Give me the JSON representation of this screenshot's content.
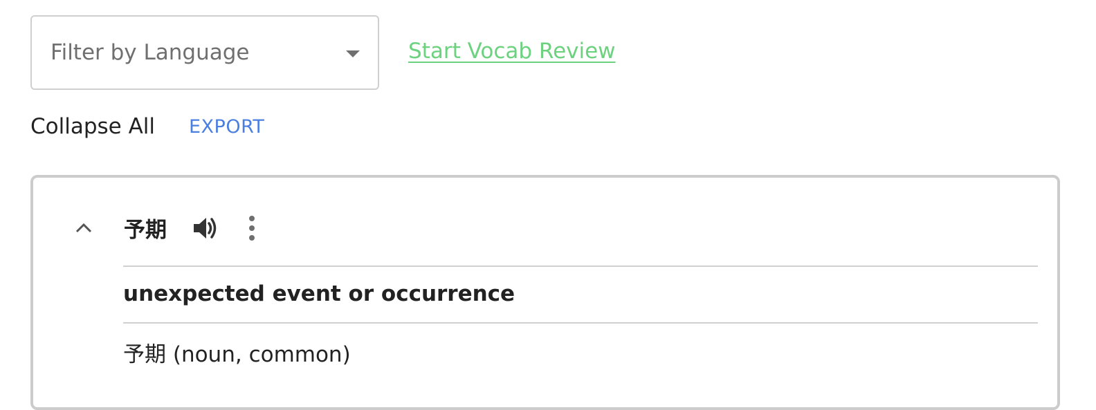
{
  "filter": {
    "placeholder": "Filter by Language",
    "icon": "caret-down-icon"
  },
  "review_link": {
    "label": "Start Vocab Review",
    "color": "#6dd27f"
  },
  "toolbar": {
    "collapse_label": "Collapse All",
    "export_label": "EXPORT",
    "export_color": "#4a7fe0"
  },
  "vocab_card": {
    "term": "予期",
    "icons": [
      "chevron-up-icon",
      "speaker-icon",
      "more-vertical-icon"
    ],
    "meaning": "unexpected event or occurrence",
    "reading": "予期 (noun, common)"
  }
}
